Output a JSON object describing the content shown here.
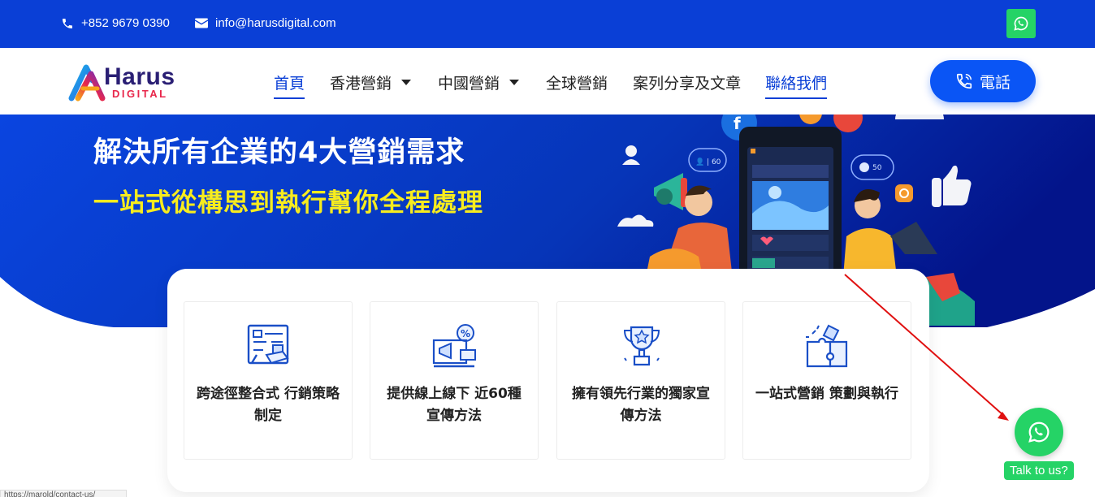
{
  "topbar": {
    "phone": "+852 9679 0390",
    "email": "info@harusdigital.com",
    "whatsapp_icon": "whatsapp-icon"
  },
  "logo": {
    "word": "Harus",
    "sub": "DIGITAL"
  },
  "nav": {
    "items": [
      {
        "label": "首頁",
        "active": true,
        "dropdown": false
      },
      {
        "label": "香港營銷",
        "active": false,
        "dropdown": true
      },
      {
        "label": "中國營銷",
        "active": false,
        "dropdown": true
      },
      {
        "label": "全球營銷",
        "active": false,
        "dropdown": false
      },
      {
        "label": "案列分享及文章",
        "active": false,
        "dropdown": false
      },
      {
        "label": "聯絡我們",
        "active": false,
        "dropdown": false
      }
    ],
    "call_label": "電話"
  },
  "hero": {
    "title": "解決所有企業的4大營銷需求",
    "subtitle": "一站式從構思到執行幫你全程處理"
  },
  "features": [
    {
      "label": "跨途徑整合式 行銷策略制定",
      "icon": "strategy-board-icon"
    },
    {
      "label": "提供線上線下 近60種宣傳方法",
      "icon": "marketing-megaphone-icon"
    },
    {
      "label": "擁有領先行業的獨家宣傳方法",
      "icon": "trophy-icon"
    },
    {
      "label": "一站式營銷 策劃與執行",
      "icon": "puzzle-icon"
    }
  ],
  "whatsapp_float": {
    "label": "Talk to us?"
  },
  "status_bar": {
    "url": "https://marold/contact-us/"
  },
  "colors": {
    "primary_blue": "#0a3fd6",
    "button_blue": "#0a55f5",
    "hero_yellow": "#f7ec1e",
    "whatsapp_green": "#25d366",
    "annotation_red": "#e01010"
  }
}
